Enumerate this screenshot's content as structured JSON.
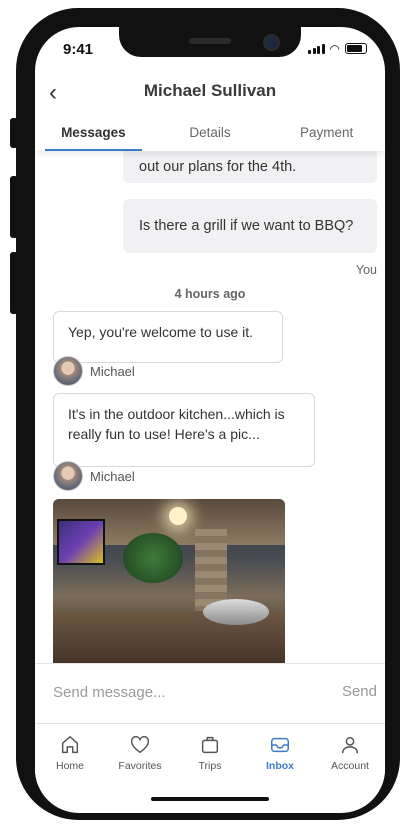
{
  "status_bar": {
    "time": "9:41"
  },
  "header": {
    "title": "Michael Sullivan"
  },
  "tabs": [
    {
      "label": "Messages",
      "active": true
    },
    {
      "label": "Details",
      "active": false
    },
    {
      "label": "Payment",
      "active": false
    }
  ],
  "messages": {
    "partial_outgoing": "out our plans for the 4th.",
    "outgoing_1": "Is there a grill if we want to BBQ?",
    "outgoing_sender": "You",
    "time_divider": "4 hours ago",
    "incoming_1": "Yep, you're welcome to use it.",
    "incoming_1_sender": "Michael",
    "incoming_2": "It's in the outdoor kitchen...which is really fun to use! Here's a pic...",
    "incoming_2_sender": "Michael"
  },
  "compose": {
    "placeholder": "Send message...",
    "send_label": "Send"
  },
  "nav": [
    {
      "label": "Home",
      "icon": "home-icon",
      "active": false
    },
    {
      "label": "Favorites",
      "icon": "heart-icon",
      "active": false
    },
    {
      "label": "Trips",
      "icon": "suitcase-icon",
      "active": false
    },
    {
      "label": "Inbox",
      "icon": "inbox-icon",
      "active": true
    },
    {
      "label": "Account",
      "icon": "person-icon",
      "active": false
    }
  ],
  "colors": {
    "accent": "#3d7ac7",
    "bubble_out": "#f1f1f3"
  }
}
